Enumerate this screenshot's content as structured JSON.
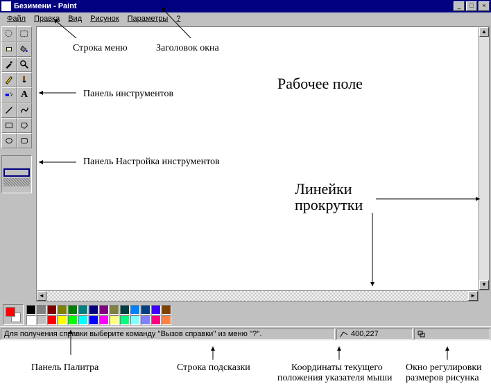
{
  "window": {
    "title": "Безимени - Paint",
    "min": "_",
    "max": "□",
    "close": "×"
  },
  "menu": {
    "file": "Файл",
    "edit": "Правка",
    "view": "Вид",
    "image": "Рисунок",
    "options": "Параметры",
    "help": "?"
  },
  "status": {
    "hint": "Для получения справки выберите команду ''Вызов справки'' из меню ''?''.",
    "coords": "400,227",
    "size": ""
  },
  "palette": {
    "fg": "#ff0000",
    "bg": "#ffffff",
    "colors": [
      "#000000",
      "#ffffff",
      "#808080",
      "#c0c0c0",
      "#800000",
      "#ff0000",
      "#808000",
      "#ffff00",
      "#008000",
      "#00ff00",
      "#008080",
      "#00ffff",
      "#000080",
      "#0000ff",
      "#800080",
      "#ff00ff",
      "#808040",
      "#ffff80",
      "#004040",
      "#00ff80",
      "#0080ff",
      "#80ffff",
      "#004080",
      "#8080ff",
      "#4000ff",
      "#ff0080",
      "#804000",
      "#ff8040"
    ]
  },
  "annotations": {
    "menu_row": "Строка меню",
    "title_caption": "Заголовок окна",
    "tools_panel": "Панель инструментов",
    "tool_options": "Панель Настройка инструментов",
    "work_area": "Рабочее поле",
    "scrollbars_l1": "Линейки",
    "scrollbars_l2": "прокрутки",
    "palette_panel": "Панель Палитра",
    "hint_bar": "Строка подсказки",
    "pointer_coords_l1": "Координаты текущего",
    "pointer_coords_l2": "положения указателя мыши",
    "size_box_l1": "Окно регулировки",
    "size_box_l2": "размеров рисунка"
  }
}
